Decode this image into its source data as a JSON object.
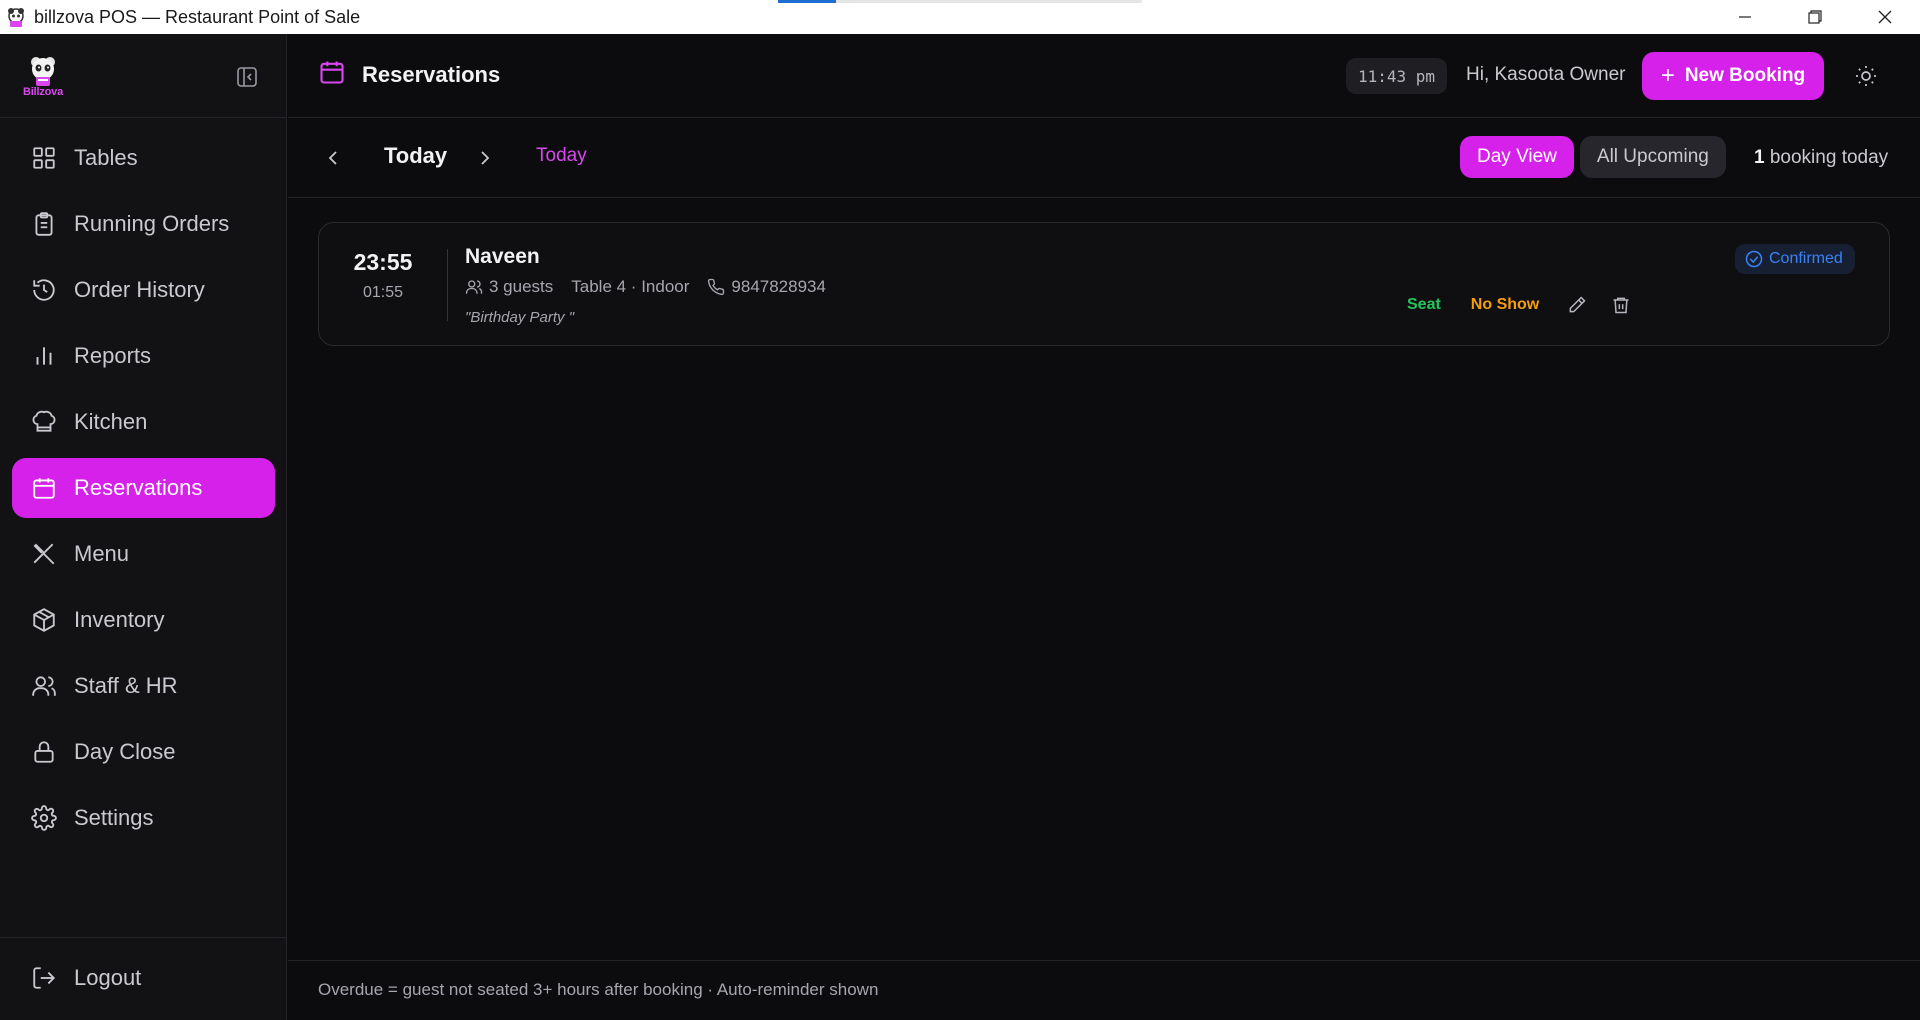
{
  "window": {
    "title": "billzova POS — Restaurant Point of Sale",
    "loading_progress": 0.16
  },
  "sidebar": {
    "logo_text": "Billzova",
    "items": [
      {
        "label": "Tables",
        "icon": "grid-icon",
        "active": false
      },
      {
        "label": "Running Orders",
        "icon": "clipboard-icon",
        "active": false
      },
      {
        "label": "Order History",
        "icon": "history-icon",
        "active": false
      },
      {
        "label": "Reports",
        "icon": "bar-chart-icon",
        "active": false
      },
      {
        "label": "Kitchen",
        "icon": "chef-hat-icon",
        "active": false
      },
      {
        "label": "Reservations",
        "icon": "calendar-icon",
        "active": true
      },
      {
        "label": "Menu",
        "icon": "utensils-icon",
        "active": false
      },
      {
        "label": "Inventory",
        "icon": "package-icon",
        "active": false
      },
      {
        "label": "Staff & HR",
        "icon": "users-icon",
        "active": false
      },
      {
        "label": "Day Close",
        "icon": "lock-icon",
        "active": false
      },
      {
        "label": "Settings",
        "icon": "gear-icon",
        "active": false
      }
    ],
    "logout_label": "Logout"
  },
  "header": {
    "title": "Reservations",
    "clock": "11:43 pm",
    "greeting": "Hi, Kasoota Owner",
    "new_booking_label": "New Booking"
  },
  "datebar": {
    "date_label": "Today",
    "today_link": "Today",
    "day_view_label": "Day View",
    "all_upcoming_label": "All Upcoming",
    "booking_count": "1",
    "booking_count_suffix": "booking today"
  },
  "reservations": [
    {
      "time": "23:55",
      "end_time": "01:55",
      "name": "Naveen",
      "guests": "3 guests",
      "table": "Table 4 · Indoor",
      "phone": "9847828934",
      "note": "\"Birthday Party \"",
      "status": "Confirmed",
      "seat_label": "Seat",
      "no_show_label": "No Show"
    }
  ],
  "footer_note": "Overdue = guest not seated 3+ hours after booking · Auto-reminder shown",
  "colors": {
    "accent": "#d521e9",
    "seat": "#22c55e",
    "no_show": "#f59e0b",
    "confirmed": "#3b82f6"
  }
}
